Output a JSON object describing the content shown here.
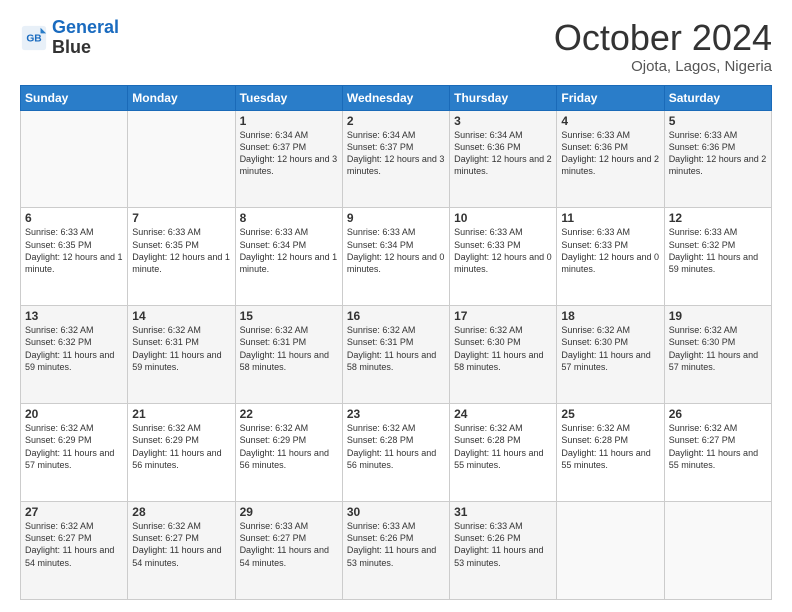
{
  "header": {
    "logo_line1": "General",
    "logo_line2": "Blue",
    "month": "October 2024",
    "location": "Ojota, Lagos, Nigeria"
  },
  "weekdays": [
    "Sunday",
    "Monday",
    "Tuesday",
    "Wednesday",
    "Thursday",
    "Friday",
    "Saturday"
  ],
  "weeks": [
    [
      {
        "day": "",
        "sunrise": "",
        "sunset": "",
        "daylight": ""
      },
      {
        "day": "",
        "sunrise": "",
        "sunset": "",
        "daylight": ""
      },
      {
        "day": "1",
        "sunrise": "Sunrise: 6:34 AM",
        "sunset": "Sunset: 6:37 PM",
        "daylight": "Daylight: 12 hours and 3 minutes."
      },
      {
        "day": "2",
        "sunrise": "Sunrise: 6:34 AM",
        "sunset": "Sunset: 6:37 PM",
        "daylight": "Daylight: 12 hours and 3 minutes."
      },
      {
        "day": "3",
        "sunrise": "Sunrise: 6:34 AM",
        "sunset": "Sunset: 6:36 PM",
        "daylight": "Daylight: 12 hours and 2 minutes."
      },
      {
        "day": "4",
        "sunrise": "Sunrise: 6:33 AM",
        "sunset": "Sunset: 6:36 PM",
        "daylight": "Daylight: 12 hours and 2 minutes."
      },
      {
        "day": "5",
        "sunrise": "Sunrise: 6:33 AM",
        "sunset": "Sunset: 6:36 PM",
        "daylight": "Daylight: 12 hours and 2 minutes."
      }
    ],
    [
      {
        "day": "6",
        "sunrise": "Sunrise: 6:33 AM",
        "sunset": "Sunset: 6:35 PM",
        "daylight": "Daylight: 12 hours and 1 minute."
      },
      {
        "day": "7",
        "sunrise": "Sunrise: 6:33 AM",
        "sunset": "Sunset: 6:35 PM",
        "daylight": "Daylight: 12 hours and 1 minute."
      },
      {
        "day": "8",
        "sunrise": "Sunrise: 6:33 AM",
        "sunset": "Sunset: 6:34 PM",
        "daylight": "Daylight: 12 hours and 1 minute."
      },
      {
        "day": "9",
        "sunrise": "Sunrise: 6:33 AM",
        "sunset": "Sunset: 6:34 PM",
        "daylight": "Daylight: 12 hours and 0 minutes."
      },
      {
        "day": "10",
        "sunrise": "Sunrise: 6:33 AM",
        "sunset": "Sunset: 6:33 PM",
        "daylight": "Daylight: 12 hours and 0 minutes."
      },
      {
        "day": "11",
        "sunrise": "Sunrise: 6:33 AM",
        "sunset": "Sunset: 6:33 PM",
        "daylight": "Daylight: 12 hours and 0 minutes."
      },
      {
        "day": "12",
        "sunrise": "Sunrise: 6:33 AM",
        "sunset": "Sunset: 6:32 PM",
        "daylight": "Daylight: 11 hours and 59 minutes."
      }
    ],
    [
      {
        "day": "13",
        "sunrise": "Sunrise: 6:32 AM",
        "sunset": "Sunset: 6:32 PM",
        "daylight": "Daylight: 11 hours and 59 minutes."
      },
      {
        "day": "14",
        "sunrise": "Sunrise: 6:32 AM",
        "sunset": "Sunset: 6:31 PM",
        "daylight": "Daylight: 11 hours and 59 minutes."
      },
      {
        "day": "15",
        "sunrise": "Sunrise: 6:32 AM",
        "sunset": "Sunset: 6:31 PM",
        "daylight": "Daylight: 11 hours and 58 minutes."
      },
      {
        "day": "16",
        "sunrise": "Sunrise: 6:32 AM",
        "sunset": "Sunset: 6:31 PM",
        "daylight": "Daylight: 11 hours and 58 minutes."
      },
      {
        "day": "17",
        "sunrise": "Sunrise: 6:32 AM",
        "sunset": "Sunset: 6:30 PM",
        "daylight": "Daylight: 11 hours and 58 minutes."
      },
      {
        "day": "18",
        "sunrise": "Sunrise: 6:32 AM",
        "sunset": "Sunset: 6:30 PM",
        "daylight": "Daylight: 11 hours and 57 minutes."
      },
      {
        "day": "19",
        "sunrise": "Sunrise: 6:32 AM",
        "sunset": "Sunset: 6:30 PM",
        "daylight": "Daylight: 11 hours and 57 minutes."
      }
    ],
    [
      {
        "day": "20",
        "sunrise": "Sunrise: 6:32 AM",
        "sunset": "Sunset: 6:29 PM",
        "daylight": "Daylight: 11 hours and 57 minutes."
      },
      {
        "day": "21",
        "sunrise": "Sunrise: 6:32 AM",
        "sunset": "Sunset: 6:29 PM",
        "daylight": "Daylight: 11 hours and 56 minutes."
      },
      {
        "day": "22",
        "sunrise": "Sunrise: 6:32 AM",
        "sunset": "Sunset: 6:29 PM",
        "daylight": "Daylight: 11 hours and 56 minutes."
      },
      {
        "day": "23",
        "sunrise": "Sunrise: 6:32 AM",
        "sunset": "Sunset: 6:28 PM",
        "daylight": "Daylight: 11 hours and 56 minutes."
      },
      {
        "day": "24",
        "sunrise": "Sunrise: 6:32 AM",
        "sunset": "Sunset: 6:28 PM",
        "daylight": "Daylight: 11 hours and 55 minutes."
      },
      {
        "day": "25",
        "sunrise": "Sunrise: 6:32 AM",
        "sunset": "Sunset: 6:28 PM",
        "daylight": "Daylight: 11 hours and 55 minutes."
      },
      {
        "day": "26",
        "sunrise": "Sunrise: 6:32 AM",
        "sunset": "Sunset: 6:27 PM",
        "daylight": "Daylight: 11 hours and 55 minutes."
      }
    ],
    [
      {
        "day": "27",
        "sunrise": "Sunrise: 6:32 AM",
        "sunset": "Sunset: 6:27 PM",
        "daylight": "Daylight: 11 hours and 54 minutes."
      },
      {
        "day": "28",
        "sunrise": "Sunrise: 6:32 AM",
        "sunset": "Sunset: 6:27 PM",
        "daylight": "Daylight: 11 hours and 54 minutes."
      },
      {
        "day": "29",
        "sunrise": "Sunrise: 6:33 AM",
        "sunset": "Sunset: 6:27 PM",
        "daylight": "Daylight: 11 hours and 54 minutes."
      },
      {
        "day": "30",
        "sunrise": "Sunrise: 6:33 AM",
        "sunset": "Sunset: 6:26 PM",
        "daylight": "Daylight: 11 hours and 53 minutes."
      },
      {
        "day": "31",
        "sunrise": "Sunrise: 6:33 AM",
        "sunset": "Sunset: 6:26 PM",
        "daylight": "Daylight: 11 hours and 53 minutes."
      },
      {
        "day": "",
        "sunrise": "",
        "sunset": "",
        "daylight": ""
      },
      {
        "day": "",
        "sunrise": "",
        "sunset": "",
        "daylight": ""
      }
    ]
  ]
}
